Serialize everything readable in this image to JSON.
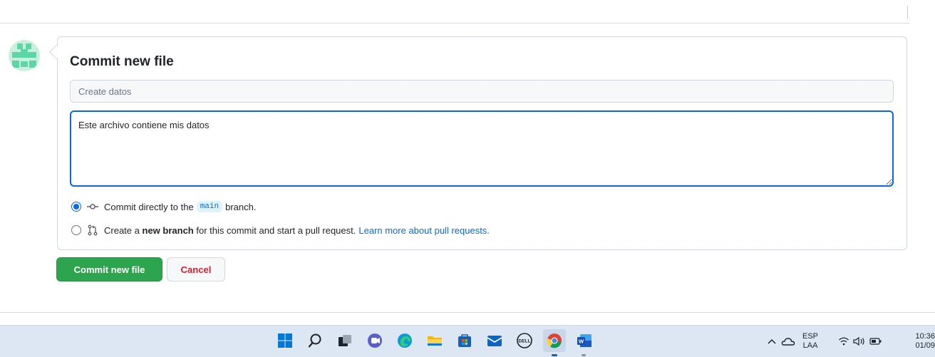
{
  "form": {
    "title": "Commit new file",
    "summary_placeholder": "Create datos",
    "summary_value": "",
    "description_value": "Este archivo contiene mis datos",
    "option_direct": {
      "prefix": "Commit directly to the",
      "branch": "main",
      "suffix": "branch."
    },
    "option_new_branch": {
      "prefix": "Create a",
      "bold": "new branch",
      "suffix": "for this commit and start a pull request.",
      "link": "Learn more about pull requests."
    },
    "selected_option": "direct"
  },
  "buttons": {
    "commit_label": "Commit new file",
    "cancel_label": "Cancel"
  },
  "taskbar": {
    "apps": [
      "start-icon",
      "search-icon",
      "task-view-icon",
      "teams-chat-icon",
      "edge-icon",
      "file-explorer-icon",
      "microsoft-store-icon",
      "mail-icon",
      "dell-icon",
      "chrome-icon",
      "word-icon"
    ],
    "tray": {
      "language_top": "ESP",
      "language_bottom": "LAA",
      "time": "10:36",
      "date": "01/09"
    }
  },
  "colors": {
    "primary_button": "#2da44e",
    "accent_blue": "#0969da",
    "cancel_text": "#cf222e",
    "taskbar_bg": "#dde6f3"
  }
}
